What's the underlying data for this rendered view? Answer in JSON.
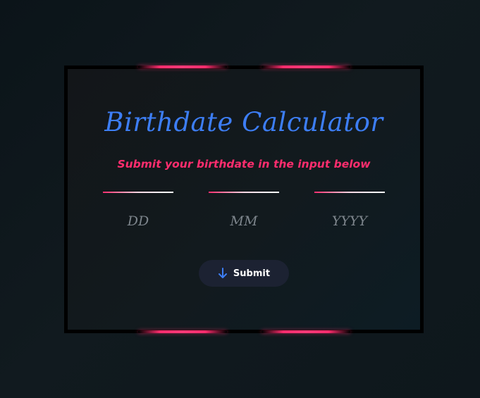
{
  "title": "Birthdate Calculator",
  "subtitle": "Submit your birthdate in the input below",
  "fields": {
    "day": {
      "placeholder": "DD",
      "value": ""
    },
    "month": {
      "placeholder": "MM",
      "value": ""
    },
    "year": {
      "placeholder": "YYYY",
      "value": ""
    }
  },
  "submit": {
    "label": "Submit",
    "icon": "arrow-down-icon"
  },
  "colors": {
    "accent_blue": "#3d7ef5",
    "accent_pink": "#ff2d6e",
    "button_bg": "#1c2232"
  }
}
